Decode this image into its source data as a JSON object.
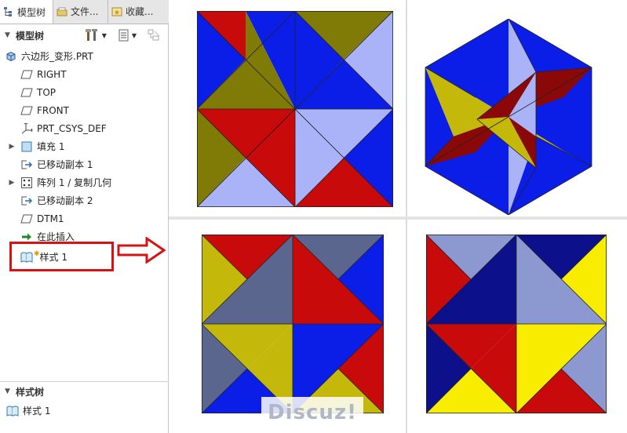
{
  "tabs": [
    {
      "label": "模型树",
      "icon": "model-tree-icon"
    },
    {
      "label": "文件...",
      "icon": "folder-icon"
    },
    {
      "label": "收藏...",
      "icon": "favorites-icon"
    }
  ],
  "model_tree": {
    "header": "模型树",
    "items": [
      {
        "label": "六边形_变形.PRT",
        "icon": "part-icon"
      },
      {
        "label": "RIGHT",
        "icon": "datum-plane-icon"
      },
      {
        "label": "TOP",
        "icon": "datum-plane-icon"
      },
      {
        "label": "FRONT",
        "icon": "datum-plane-icon"
      },
      {
        "label": "PRT_CSYS_DEF",
        "icon": "csys-icon"
      },
      {
        "label": "填充 1",
        "icon": "fill-icon"
      },
      {
        "label": "已移动副本 1",
        "icon": "moved-copy-icon"
      },
      {
        "label": "阵列 1 / 复制几何",
        "icon": "pattern-icon"
      },
      {
        "label": "已移动副本 2",
        "icon": "moved-copy-icon"
      },
      {
        "label": "DTM1",
        "icon": "datum-plane-icon"
      },
      {
        "label": "在此插入",
        "icon": "insert-here-icon"
      },
      {
        "label": "样式 1",
        "icon": "style-icon"
      }
    ]
  },
  "style_tree": {
    "header": "样式树",
    "items": [
      {
        "label": "样式 1",
        "icon": "style-icon"
      }
    ]
  },
  "watermark": "Discuz!",
  "colors": {
    "red": "#c80a0a",
    "olive": "#807a06",
    "blue": "#0a1ee8",
    "light_blue": "#aab2f8",
    "dark_red": "#8a0808",
    "yellow_olive": "#c4b80a",
    "yellow": "#f8ec00",
    "slate": "#5a668e",
    "navy": "#0c108a",
    "periwinkle": "#8c98d0",
    "highlight_red": "#d41414"
  }
}
